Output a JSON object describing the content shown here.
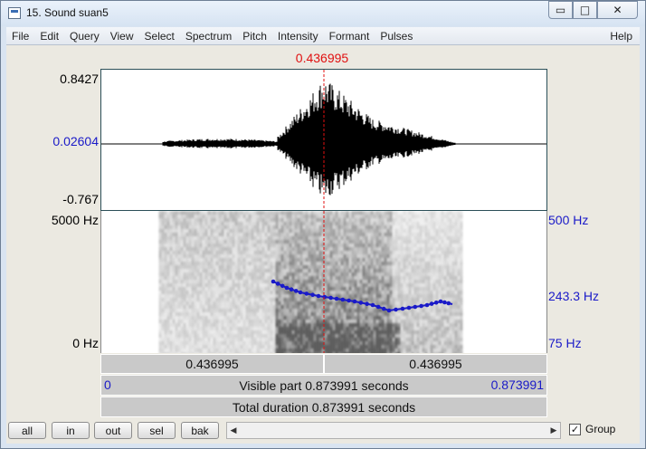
{
  "window": {
    "title": "15. Sound suan5",
    "min_glyph": "▭",
    "max_glyph": "□",
    "close_glyph": "✕"
  },
  "menu": [
    "File",
    "Edit",
    "Query",
    "View",
    "Select",
    "Spectrum",
    "Pitch",
    "Intensity",
    "Formant",
    "Pulses"
  ],
  "menu_help": "Help",
  "cursor_time_top": "0.436995",
  "waveform": {
    "y_max": "0.8427",
    "y_mid": "0.02604",
    "y_min": "-0.767"
  },
  "spectrogram": {
    "freq_top": "5000 Hz",
    "freq_bottom": "0 Hz",
    "pitch_top": "500 Hz",
    "pitch_mid": "243.3 Hz",
    "pitch_bottom": "75 Hz"
  },
  "bars": {
    "left_part": "0.436995",
    "right_part": "0.436995",
    "visible_start": "0",
    "visible_label": "Visible part 0.873991 seconds",
    "visible_end": "0.873991",
    "total_label": "Total duration 0.873991 seconds"
  },
  "toolbar": {
    "all": "all",
    "in": "in",
    "out": "out",
    "sel": "sel",
    "bak": "bak",
    "group_label": "Group",
    "group_checked": "✓"
  },
  "colors": {
    "cursor": "#e01010",
    "pitch": "#1a1ac8"
  }
}
